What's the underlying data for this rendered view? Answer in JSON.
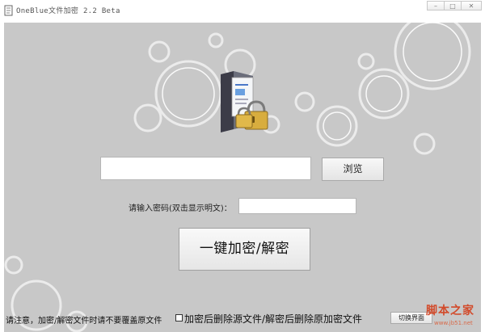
{
  "window": {
    "title": "OneBlue文件加密 2.2 Beta",
    "min_label": "–",
    "max_label": "□",
    "close_label": "✕"
  },
  "file": {
    "value": "",
    "browse_label": "浏览"
  },
  "password": {
    "label": "请输入密码(双击显示明文)：",
    "value": ""
  },
  "main_action": {
    "label": "一键加密/解密"
  },
  "footer": {
    "notice": "请注意，加密/解密文件时请不要覆盖原文件",
    "delete_source_label": "加密后删除源文件/解密后删除原加密文件",
    "delete_source_checked": false,
    "switch_label": "切换界面"
  },
  "watermark": {
    "text": "脚本之家",
    "url": "www.jb51.net"
  },
  "icons": {
    "app": "app-file-icon",
    "hero": "folder-lock-icon"
  },
  "colors": {
    "background": "#c8c8c8",
    "watermark": "#d24a2a"
  }
}
